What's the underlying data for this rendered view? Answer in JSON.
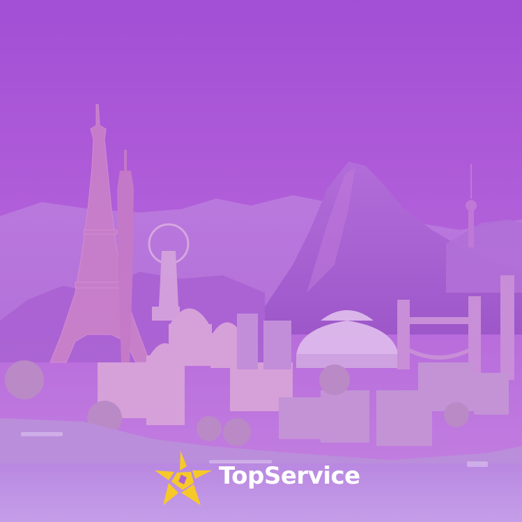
{
  "brand": {
    "name": "TopService",
    "logo_icon": "star-logo-icon",
    "logo_color": "#f7c928",
    "text_color": "#ffffff"
  },
  "background": {
    "description_icon": "world-landmarks-collage",
    "overlay_color": "#a855d6"
  }
}
